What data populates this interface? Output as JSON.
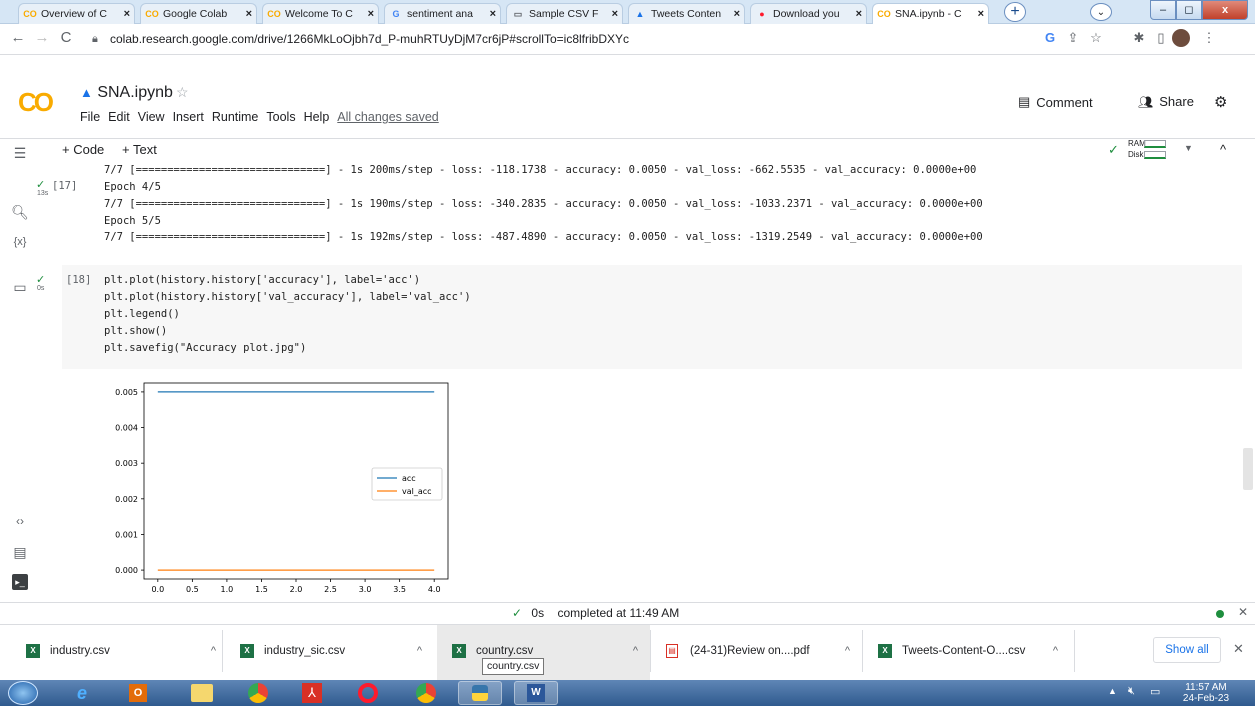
{
  "browser": {
    "tabs": [
      {
        "icon": "colab-icon",
        "title": "Overview of C"
      },
      {
        "icon": "colab-icon",
        "title": "Google Colab"
      },
      {
        "icon": "colab-icon",
        "title": "Welcome To C"
      },
      {
        "icon": "google-icon",
        "title": "sentiment ana"
      },
      {
        "icon": "file-icon",
        "title": "Sample CSV F"
      },
      {
        "icon": "drive-icon",
        "title": "Tweets Conten"
      },
      {
        "icon": "opera-icon",
        "title": "Download you"
      },
      {
        "icon": "colab-icon",
        "title": "SNA.ipynb - C"
      }
    ],
    "url": "colab.research.google.com/drive/1266MkLoOjbh7d_P-muhRTUyDjM7cr6jP#scrollTo=ic8lfribDXYc"
  },
  "colab": {
    "logo": "CO",
    "filename": "SNA.ipynb",
    "menu": [
      "File",
      "Edit",
      "View",
      "Insert",
      "Runtime",
      "Tools",
      "Help"
    ],
    "saved_status": "All changes saved",
    "comment_label": "Comment",
    "share_label": "Share",
    "add_code": "+ Code",
    "add_text": "+ Text",
    "ram_label": "RAM",
    "disk_label": "Disk"
  },
  "cell17": {
    "prompt": "[17]",
    "runtime": "13s",
    "lines": [
      "7/7 [==============================] - 1s 200ms/step - loss: -118.1738 - accuracy: 0.0050 - val_loss: -662.5535 - val_accuracy: 0.0000e+00",
      "Epoch 4/5",
      "7/7 [==============================] - 1s 190ms/step - loss: -340.2835 - accuracy: 0.0050 - val_loss: -1033.2371 - val_accuracy: 0.0000e+00",
      "Epoch 5/5",
      "7/7 [==============================] - 1s 192ms/step - loss: -487.4890 - accuracy: 0.0050 - val_loss: -1319.2549 - val_accuracy: 0.0000e+00"
    ]
  },
  "cell18": {
    "prompt": "[18]",
    "runtime": "0s",
    "lines": [
      "plt.plot(history.history['accuracy'], label='acc')",
      "plt.plot(history.history['val_accuracy'], label='val_acc')",
      "plt.legend()",
      "plt.show()",
      "plt.savefig(\"Accuracy plot.jpg\")"
    ]
  },
  "chart_data": {
    "type": "line",
    "x": [
      0.0,
      1.0,
      2.0,
      3.0,
      4.0
    ],
    "series": [
      {
        "name": "acc",
        "values": [
          0.005,
          0.005,
          0.005,
          0.005,
          0.005
        ],
        "color": "#1f77b4"
      },
      {
        "name": "val_acc",
        "values": [
          0.0,
          0.0,
          0.0,
          0.0,
          0.0
        ],
        "color": "#ff7f0e"
      }
    ],
    "xticks": [
      "0.0",
      "0.5",
      "1.0",
      "1.5",
      "2.0",
      "2.5",
      "3.0",
      "3.5",
      "4.0"
    ],
    "yticks": [
      "0.000",
      "0.001",
      "0.002",
      "0.003",
      "0.004",
      "0.005"
    ],
    "xlim": [
      -0.2,
      4.2
    ],
    "ylim": [
      -0.00025,
      0.00525
    ],
    "legend": "center-right"
  },
  "status": {
    "check": "✓",
    "duration": "0s",
    "text": "completed at 11:49 AM"
  },
  "downloads": {
    "items": [
      {
        "name": "industry.csv",
        "type": "xls"
      },
      {
        "name": "industry_sic.csv",
        "type": "xls"
      },
      {
        "name": "country.csv",
        "type": "xls"
      },
      {
        "name": "(24-31)Review on....pdf",
        "type": "pdf"
      },
      {
        "name": "Tweets-Content-O....csv",
        "type": "xls"
      }
    ],
    "tooltip": "country.csv",
    "show_all": "Show all"
  },
  "taskbar": {
    "time": "11:57 AM",
    "date": "24-Feb-23"
  }
}
